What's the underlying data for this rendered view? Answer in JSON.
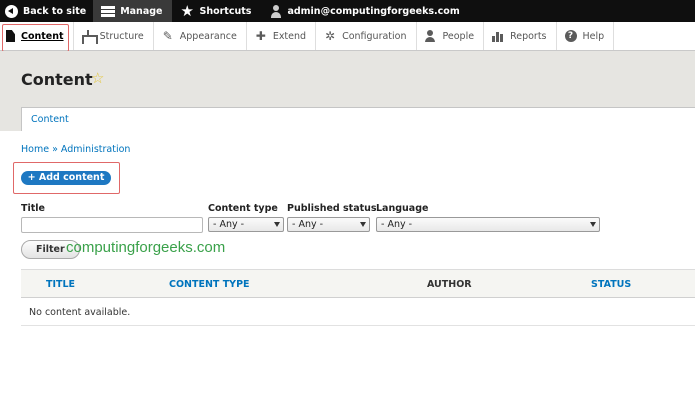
{
  "toolbar": {
    "back": "Back to site",
    "manage": "Manage",
    "shortcuts": "Shortcuts",
    "user": "admin@computingforgeeks.com"
  },
  "tray": {
    "items": [
      "Content",
      "Structure",
      "Appearance",
      "Extend",
      "Configuration",
      "People",
      "Reports",
      "Help"
    ]
  },
  "page": {
    "title": "Content",
    "tab": "Content",
    "breadcrumb": "Home » Administration",
    "add_button": "+ Add content"
  },
  "filters": {
    "title_label": "Title",
    "title_value": "",
    "type_label": "Content type",
    "type_value": "- Any -",
    "status_label": "Published status",
    "status_value": "- Any -",
    "language_label": "Language",
    "language_value": "- Any -",
    "filter_button": "Filter"
  },
  "watermark": "computingforgeeks.com",
  "table": {
    "headers": [
      "TITLE",
      "CONTENT TYPE",
      "AUTHOR",
      "STATUS"
    ],
    "empty": "No content available."
  },
  "colors": {
    "link": "#0074bd",
    "button": "#1e78c2",
    "highlight": "#e06868",
    "watermark": "#3aa14a"
  }
}
